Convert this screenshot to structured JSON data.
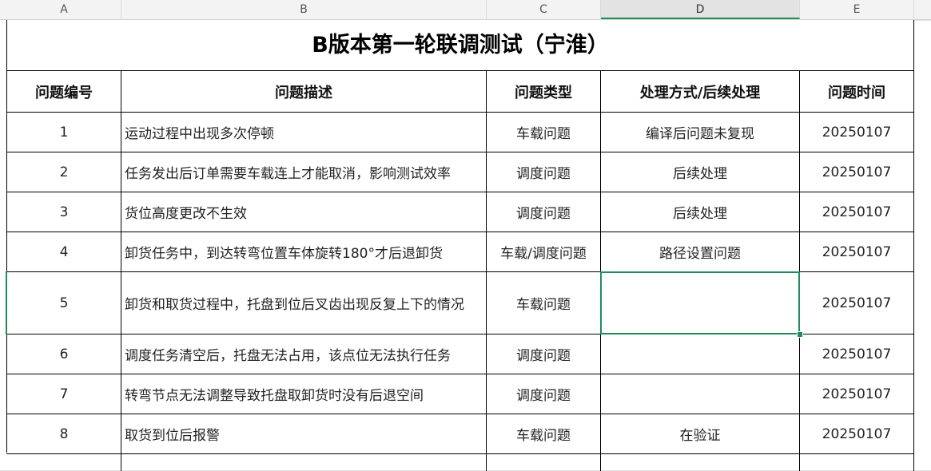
{
  "column_headers": [
    "A",
    "B",
    "C",
    "D",
    "E"
  ],
  "selected_column": "D",
  "title": "B版本第一轮联调测试（宁淮）",
  "table": {
    "headers": [
      "问题编号",
      "问题描述",
      "问题类型",
      "处理方式/后续处理",
      "问题时间"
    ],
    "rows": [
      [
        "1",
        "运动过程中出现多次停顿",
        "车载问题",
        "编译后问题未复现",
        "20250107"
      ],
      [
        "2",
        "任务发出后订单需要车载连上才能取消，影响测试效率",
        "调度问题",
        "后续处理",
        "20250107"
      ],
      [
        "3",
        "货位高度更改不生效",
        "调度问题",
        "后续处理",
        "20250107"
      ],
      [
        "4",
        "卸货任务中，到达转弯位置车体旋转180°才后退卸货",
        "车载/调度问题",
        "路径设置问题",
        "20250107"
      ],
      [
        "5",
        "卸货和取货过程中，托盘到位后叉齿出现反复上下的情况",
        "车载问题",
        "",
        "20250107"
      ],
      [
        "6",
        "调度任务清空后，托盘无法占用，该点位无法执行任务",
        "调度问题",
        "",
        "20250107"
      ],
      [
        "7",
        "转弯节点无法调整导致托盘取卸货时没有后退空间",
        "调度问题",
        "",
        "20250107"
      ],
      [
        "8",
        "取货到位后报警",
        "车载问题",
        "在验证",
        "20250107"
      ]
    ]
  }
}
